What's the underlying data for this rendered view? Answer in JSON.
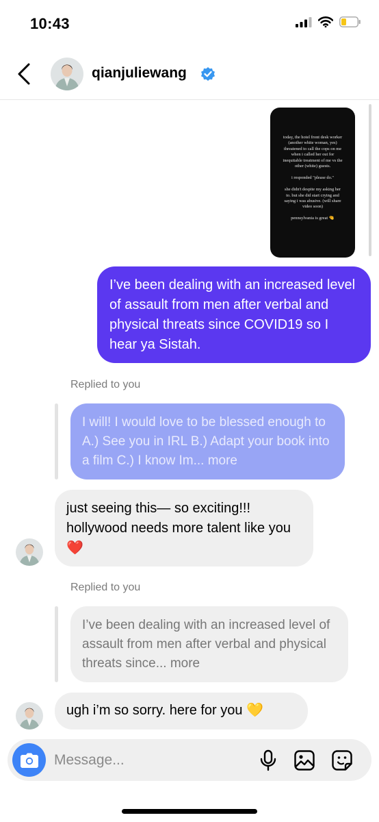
{
  "status_bar": {
    "time": "10:43",
    "icons": [
      "signal-icon",
      "wifi-icon",
      "battery-low-icon"
    ],
    "battery_color": "#f5c518"
  },
  "header": {
    "username": "qianjuliewang",
    "verified": true,
    "badge_color": "#3897f0"
  },
  "thread": {
    "story_text": "today, the hotel front desk worker (another white woman, yes) threatened to call the cops on me when i called her out for inequitable treatment of me vs the other (white) guests.\n\ni responded \"please do.\"\n\nshe didn't despite my asking her to. but she did start crying and saying i was abusive. (will share video soon)\n\npennsylvania is great 🤏",
    "sent_message": "I’ve been dealing with an increased level of assault from men after verbal and physical threats since COVID19 so I hear ya Sistah.",
    "reply_1": {
      "label": "Replied to you",
      "quoted": "I will! I would love to be blessed enough to A.) See you in IRL B.) Adapt your book into a film C.) I know Im... more",
      "message": "just seeing this— so exciting!!! hollywood needs more talent like you ❤️"
    },
    "reply_2": {
      "label": "Replied to you",
      "quoted": "I’ve been dealing with an increased level of assault from men after verbal and physical threats since... more",
      "message": "ugh i’m so sorry. here for you 💛"
    }
  },
  "composer": {
    "placeholder": "Message...",
    "icons": [
      "camera-icon",
      "microphone-icon",
      "gallery-icon",
      "sticker-icon"
    ]
  },
  "colors": {
    "sent_bubble": "#5b38f0",
    "quoted_own_bubble": "#98a5f5",
    "received_bubble": "#efefef",
    "camera_button": "#3d83f7"
  }
}
